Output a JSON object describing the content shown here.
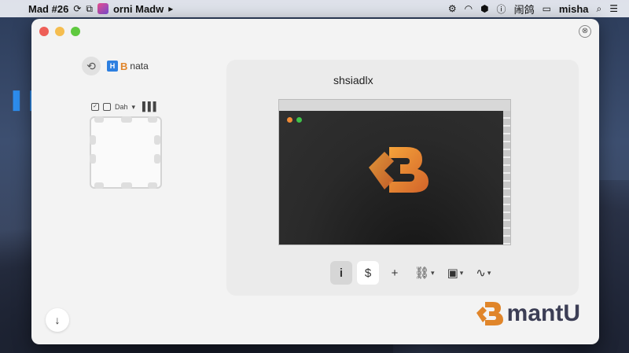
{
  "menubar": {
    "apple": "",
    "app_title": "Mad #26",
    "app_name": "orni Madw",
    "user": "misha",
    "left_icons": [
      "sync-icon",
      "copy-icon",
      "app-icon",
      "cast-icon"
    ],
    "right_icons": [
      "gear-icon",
      "wifi-icon",
      "shield-icon",
      "battery-icon",
      "search-icon",
      "menu-icon"
    ],
    "status_text": "闹鸽"
  },
  "window": {
    "close_glyph": "⊗"
  },
  "sidebar": {
    "chip_icon_text": "H",
    "chip_logo": "B",
    "chip_label": "nata",
    "mini_toolbar": {
      "label": "Dah",
      "caret": "▾",
      "grid_glyph": "▐▐▐"
    }
  },
  "panel": {
    "title": "shsiadlx"
  },
  "toolbar": {
    "info_glyph": "i",
    "dollar_glyph": "$",
    "plus_glyph": "+",
    "link_glyph": "⛓",
    "image_glyph": "▣",
    "wave_glyph": "∿",
    "caret": "▾"
  },
  "footer": {
    "corner_glyph": "↓",
    "brand_name": "mantU"
  },
  "colors": {
    "brand_orange": "#e0852a",
    "brand_dark": "#3c3e55",
    "accent_blue": "#2d7fe0"
  }
}
